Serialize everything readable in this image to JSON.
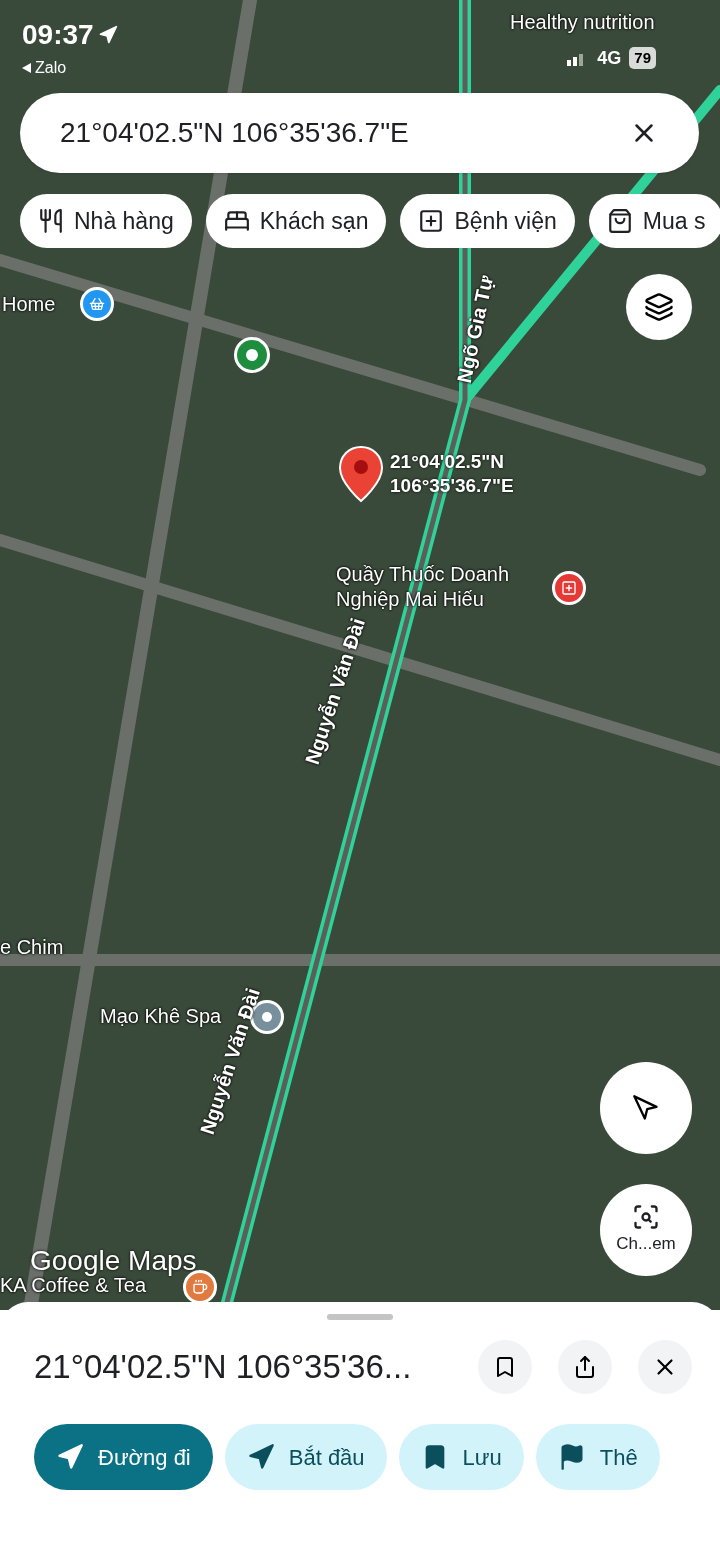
{
  "status_bar": {
    "time": "09:37",
    "back_app": "Zalo",
    "network": "4G",
    "battery": "79"
  },
  "search": {
    "value": "21°04'02.5\"N 106°35'36.7\"E"
  },
  "chips": [
    {
      "label": "Nhà hàng",
      "kind": "restaurant"
    },
    {
      "label": "Khách sạn",
      "kind": "hotel"
    },
    {
      "label": "Bệnh viện",
      "kind": "hospital"
    },
    {
      "label": "Mua s",
      "kind": "shopping"
    }
  ],
  "map": {
    "labels": [
      {
        "text": "Healthy nutrition",
        "kind": "place"
      },
      {
        "text": "Home",
        "kind": "shop"
      },
      {
        "text": "Ngõ Gia Tự",
        "kind": "street"
      },
      {
        "text": "Quầy Thuốc Doanh Nghiệp Mai Hiếu",
        "kind": "pharmacy"
      },
      {
        "text": "Nguyễn Văn Đài",
        "kind": "street"
      },
      {
        "text": "e Chim",
        "kind": "place"
      },
      {
        "text": "Mạo Khê Spa",
        "kind": "spa"
      },
      {
        "text": "Nguyễn Văn Đài",
        "kind": "street"
      },
      {
        "text": "KA Coffee & Tea",
        "kind": "cafe"
      }
    ],
    "pin": {
      "lines": [
        "21°04'02.5\"N",
        "106°35'36.7\"E"
      ]
    },
    "watermark_logo": "Google Maps",
    "camera_button": "Ch...em"
  },
  "sheet": {
    "title": "21°04'02.5\"N 106°35'36...",
    "actions": [
      {
        "label": "Đường đi",
        "kind": "directions",
        "primary": true
      },
      {
        "label": "Bắt đầu",
        "kind": "start",
        "primary": false
      },
      {
        "label": "Lưu",
        "kind": "save",
        "primary": false
      },
      {
        "label": "Thê",
        "kind": "more",
        "primary": false
      }
    ]
  }
}
